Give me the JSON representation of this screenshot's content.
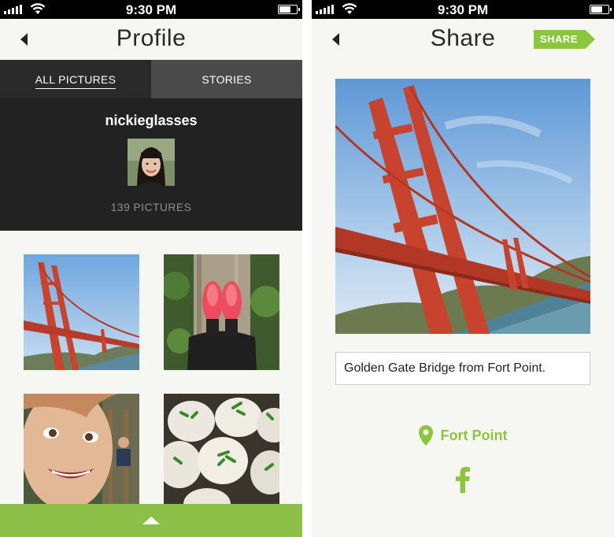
{
  "status_bar": {
    "time": "9:30 PM"
  },
  "profile_screen": {
    "title": "Profile",
    "tabs": [
      "ALL PICTURES",
      "STORIES"
    ],
    "username": "nickieglasses",
    "picture_count": "139 PICTURES",
    "grid_items": [
      "golden-gate-bridge",
      "pink-sneakers",
      "child-face",
      "buns"
    ]
  },
  "share_screen": {
    "title": "Share",
    "share_label": "SHARE",
    "caption": "Golden Gate Bridge from Fort Point.",
    "location": "Fort Point",
    "icons": [
      "map-pin-icon",
      "facebook-icon"
    ]
  },
  "colors": {
    "accent": "#8cc63f",
    "bottom_bar": "#8cbf48",
    "dark_header": "#222222"
  }
}
